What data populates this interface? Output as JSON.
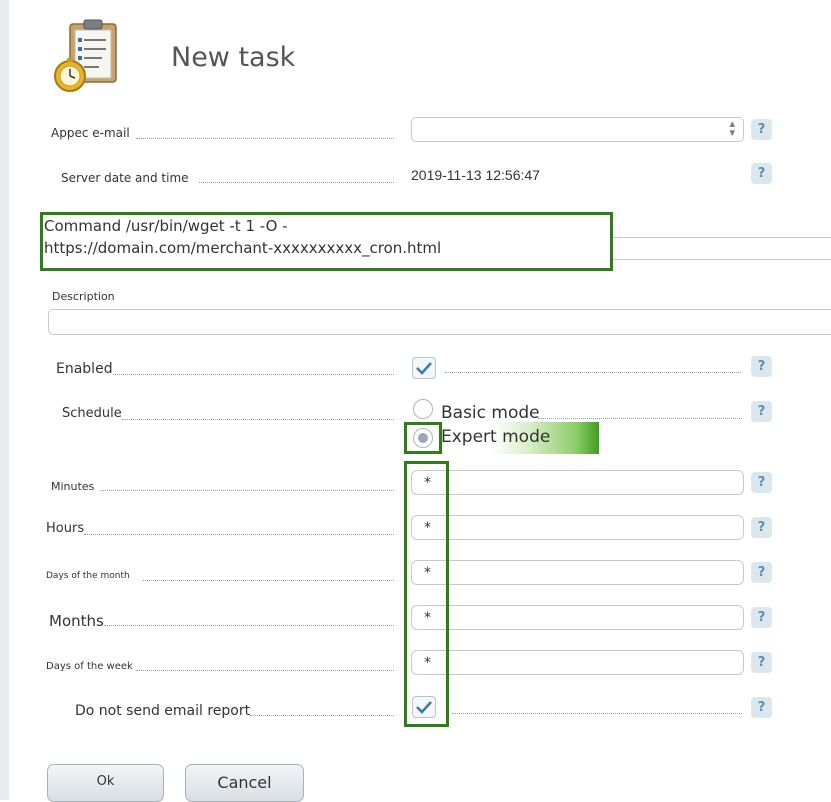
{
  "header": {
    "title": "New task",
    "icon": "task-clipboard-clock-icon"
  },
  "form": {
    "email_label": "Appec e-mail",
    "email_value": "",
    "server_time_label": "Server date and time",
    "server_time_value": "2019-11-13 12:56:47",
    "command": {
      "line1": "Command /usr/bin/wget -t 1 -O -",
      "line2": "https://domain.com/merchant-xxxxxxxxxx_cron.html"
    },
    "description_label": "Description",
    "description_value": "",
    "enabled_label": "Enabled",
    "enabled_checked": true,
    "schedule_label": "Schedule",
    "schedule_options": [
      {
        "label": "Basic mode",
        "checked": false
      },
      {
        "label": "Expert mode",
        "checked": true
      }
    ],
    "fields": [
      {
        "label": "Minutes",
        "value": "*"
      },
      {
        "label": "Hours",
        "value": "*"
      },
      {
        "label": "Days of the month",
        "value": "*"
      },
      {
        "label": "Months",
        "value": "*"
      },
      {
        "label": "Days of the week",
        "value": "*"
      }
    ],
    "no_email_label": "Do not send email report",
    "no_email_checked": true,
    "help_symbol": "?"
  },
  "buttons": {
    "ok": "Ok",
    "cancel": "Cancel"
  },
  "colors": {
    "highlight_border": "#2e7d17",
    "help_bg": "#dbe7ef",
    "help_fg": "#5d8fae",
    "check": "#3d7ca8"
  }
}
